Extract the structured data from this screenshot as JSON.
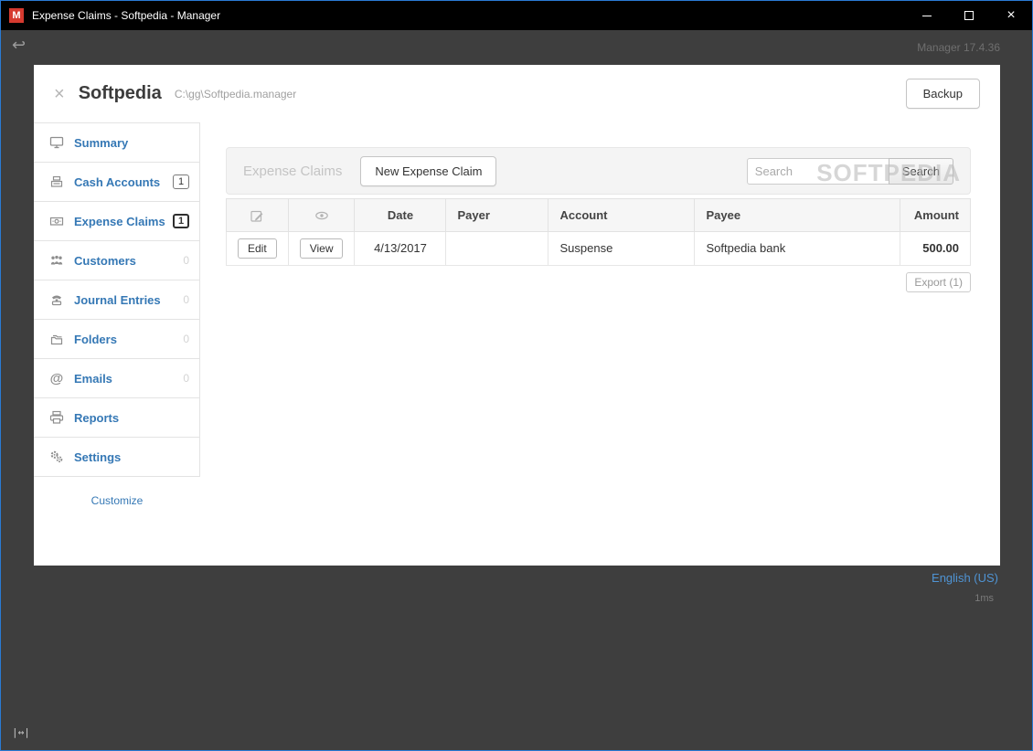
{
  "window": {
    "title": "Expense Claims - Softpedia - Manager",
    "app_icon_letter": "M",
    "version": "Manager 17.4.36",
    "resize_hint": "|&#x2194;|",
    "resize_hint_text": "|↔|",
    "back_icon": "↩"
  },
  "header": {
    "close_icon": "×",
    "business_name": "Softpedia",
    "file_path": "C:\\gg\\Softpedia.manager",
    "backup_label": "Backup"
  },
  "sidebar": {
    "items": [
      {
        "label": "Summary",
        "icon": "summary",
        "count": "",
        "active": false
      },
      {
        "label": "Cash Accounts",
        "icon": "cash-accounts",
        "count": "1",
        "active": false
      },
      {
        "label": "Expense Claims",
        "icon": "expense-claims",
        "count": "1",
        "active": true
      },
      {
        "label": "Customers",
        "icon": "customers",
        "count": "0",
        "active": false
      },
      {
        "label": "Journal Entries",
        "icon": "journal-entries",
        "count": "0",
        "active": false
      },
      {
        "label": "Folders",
        "icon": "folders",
        "count": "0",
        "active": false
      },
      {
        "label": "Emails",
        "icon": "emails",
        "count": "0",
        "active": false
      },
      {
        "label": "Reports",
        "icon": "reports",
        "count": "",
        "active": false
      },
      {
        "label": "Settings",
        "icon": "settings",
        "count": "",
        "active": false
      }
    ],
    "customize_label": "Customize"
  },
  "content": {
    "heading": "Expense Claims",
    "new_button": "New Expense Claim",
    "search_placeholder": "Search",
    "search_button": "Search",
    "watermark": "SOFTPEDIA",
    "export_label": "Export (1)",
    "table": {
      "columns": [
        "",
        "",
        "Date",
        "Payer",
        "Account",
        "Payee",
        "Amount"
      ],
      "rows": [
        {
          "edit": "Edit",
          "view": "View",
          "date": "4/13/2017",
          "payer": "",
          "account": "Suspense",
          "payee": "Softpedia bank",
          "amount": "500.00"
        }
      ]
    }
  },
  "footer": {
    "language": "English (US)",
    "timing": "1ms"
  },
  "colors": {
    "accent_blue": "#3578b5",
    "window_border_blue": "#2a7ad4",
    "titlebar_bg": "#000000",
    "app_icon_red": "#d63a2f",
    "dark_background": "#3e3e3e"
  }
}
